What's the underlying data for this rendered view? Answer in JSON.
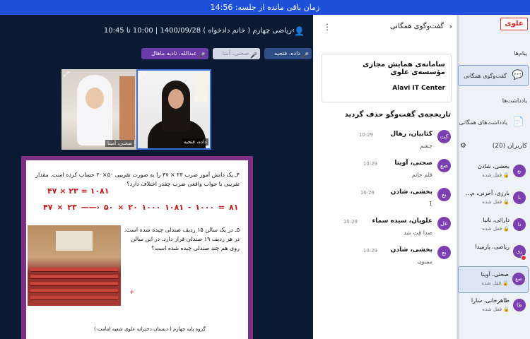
{
  "topbar": {
    "text": "زمان باقی مانده از جلسه: 14:56"
  },
  "video": {
    "header": "ریاضی چهارم ( خانم دادخواه ) 1400/09/28 | 10:00 تا 10:45",
    "user_icon": "person-icon",
    "chips": [
      {
        "label": "عبدالله، نادیه ماهال"
      },
      {
        "label": "صحنی، آمنا"
      },
      {
        "label": "داده، فتحیه"
      }
    ],
    "tiles": [
      {
        "name": "صحنی، آمینا"
      },
      {
        "name": "داده، فتحیه"
      }
    ],
    "worksheet": {
      "q4": "۴ـ یک دانش آموز ضرب ۲۳ × ۴۷ را به صورت تقریبی ۵۰×۲۰ حساب کرده است. مقدار تقریبی با جواب واقعی ضرب چقدر اختلاف دارد؟",
      "red_line1": "۴۷ × ۲۳ = ۱۰۸۱",
      "red_line2": "۴۷ × ۲۳ ——› ۵۰ × ۲۰   ۱۰۰۰     ۱۰۸۱ - ۱۰۰۰ = ۸۱",
      "q5": "۵ـ در یک سالن ۱۵ ردیف صندلی چیده شده است. در هر ردیف ۱۹ صندلی قرار دارد. در این سالن روی هم چند صندلی چیده شده است؟",
      "plus": "+",
      "footer": "گروه پایه چهارم ( دبستان دخترانه علوی شعبه امامت )"
    }
  },
  "chat": {
    "title": "گفت‌وگوی همگانی",
    "welcome_line1": "سامانه‌ی همایش مجازی مؤسسه‌ی علوی",
    "welcome_line2": "Alavi IT Center",
    "deleted": "تاریخچه‌ی گفت‌وگو حذف گردید",
    "messages": [
      {
        "initials": "کت",
        "name": "کتابیان، رهال",
        "time": "10:29",
        "text": "چشم"
      },
      {
        "initials": "صع",
        "name": "صحنی، آوینا",
        "time": "10:29",
        "text": "قلم خانم"
      },
      {
        "initials": "بع",
        "name": "بخشی، شادن",
        "time": "10:29",
        "text": "1"
      },
      {
        "initials": "عل",
        "name": "علویان، سیده سماء",
        "time": "10:29",
        "text": "صدا قت شد"
      },
      {
        "initials": "بع",
        "name": "بخشی، شادن",
        "time": "10:29",
        "text": "ممنون"
      }
    ]
  },
  "sidebar": {
    "logo": "علوی",
    "messages_section": "پیام‌ها",
    "public_chat": "گفت‌وگوی همگانی",
    "notes_section": "یادداشت‌ها",
    "shared_notes": "یادداشت‌های همگانی",
    "users_label": "کاربران (20)",
    "users": [
      {
        "initials": "بع",
        "name": "بخشی، شادن",
        "status": "قفل شده"
      },
      {
        "initials": "با",
        "name": "بارزی، آخرنی، م...",
        "status": "قفل شده"
      },
      {
        "initials": "دا",
        "name": "دارائی، نانیا",
        "status": "قفل شده"
      },
      {
        "initials": "ری",
        "name": "ریاضی، پارمیدا",
        "status": "قفل شده"
      },
      {
        "initials": "صع",
        "name": "صحنی، آوینا",
        "status": "قفل شده"
      },
      {
        "initials": "طا",
        "name": "طاهرخانی، سارا",
        "status": "قفل شده"
      }
    ]
  }
}
